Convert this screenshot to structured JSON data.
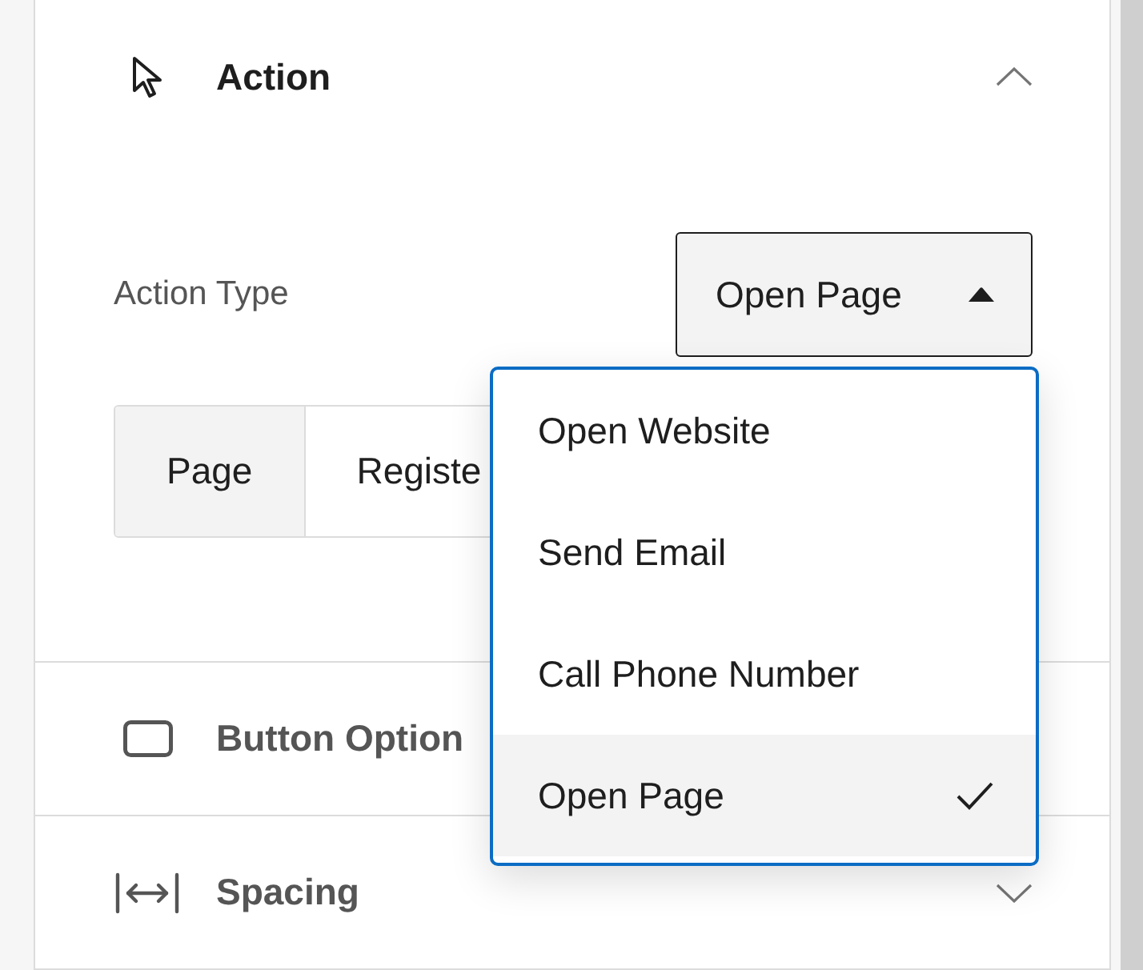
{
  "sections": [
    {
      "kind": "action",
      "title": "Action",
      "expanded": true,
      "action_type": {
        "label": "Action Type",
        "value": "Open Page",
        "open": true,
        "options": [
          {
            "label": "Open Website",
            "selected": false
          },
          {
            "label": "Send Email",
            "selected": false
          },
          {
            "label": "Call Phone Number",
            "selected": false
          },
          {
            "label": "Open Page",
            "selected": true
          }
        ]
      },
      "link_tabs": [
        {
          "label": "Page",
          "selected": true
        },
        {
          "label": "Registe",
          "selected": false
        }
      ]
    },
    {
      "kind": "button_options",
      "title": "Button Option"
    },
    {
      "kind": "spacing",
      "title": "Spacing",
      "expanded": false
    }
  ]
}
